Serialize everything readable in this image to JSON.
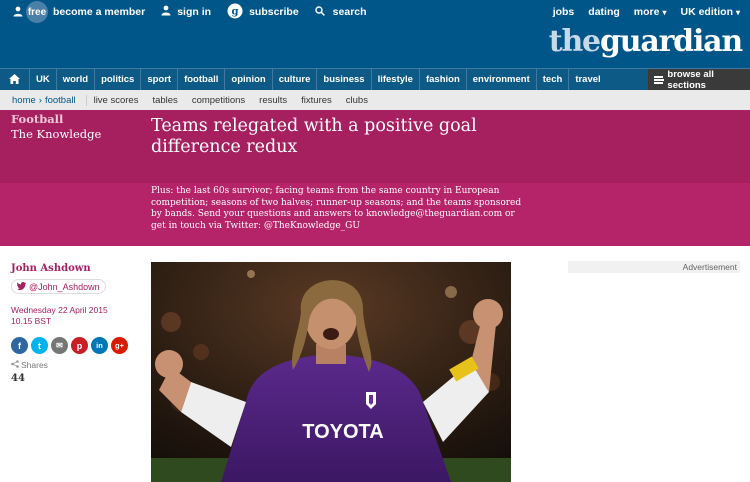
{
  "topbar": {
    "free_badge": "free",
    "become_member": "become a member",
    "sign_in": "sign in",
    "subscribe": "subscribe",
    "search": "search",
    "jobs": "jobs",
    "dating": "dating",
    "more": "more",
    "edition": "UK edition",
    "logo_the": "the",
    "logo_guardian": "guardian",
    "background_color": "#005689"
  },
  "nav": {
    "home_icon": "home-icon",
    "items": [
      "UK",
      "world",
      "politics",
      "sport",
      "football",
      "opinion",
      "culture",
      "business",
      "lifestyle",
      "fashion",
      "environment",
      "tech",
      "travel"
    ],
    "browse_all": "browse all sections"
  },
  "subnav": {
    "breadcrumb_home": "home",
    "breadcrumb_sep": "›",
    "breadcrumb_section": "football",
    "items": [
      "live scores",
      "tables",
      "competitions",
      "results",
      "fixtures",
      "clubs"
    ]
  },
  "article": {
    "section": "Football",
    "series": "The Knowledge",
    "headline": "Teams relegated with a positive goal difference redux",
    "standfirst": "Plus: the last 60s survivor; facing teams from the same country in European competition; seasons of two halves; runner-up seasons; and the teams sponsored by bands. Send your questions and answers to knowledge@theguardian.com or get in touch via Twitter: @TheKnowledge_GU",
    "author": "John Ashdown",
    "twitter_handle": "@John_Ashdown",
    "date": "Wednesday 22 April 2015",
    "time": "10.15 BST",
    "shares_label": "Shares",
    "shares_count": "44",
    "accent_color": "#a62060"
  },
  "share_buttons": [
    {
      "icon": "facebook-icon",
      "glyph": "f",
      "color": "#3067a3"
    },
    {
      "icon": "twitter-icon",
      "glyph": "t",
      "color": "#03b3ee"
    },
    {
      "icon": "email-icon",
      "glyph": "✉",
      "color": "#767676"
    },
    {
      "icon": "pinterest-icon",
      "glyph": "p",
      "color": "#cb1f27"
    },
    {
      "icon": "linkedin-icon",
      "glyph": "in",
      "color": "#0077b5"
    },
    {
      "icon": "googleplus-icon",
      "glyph": "g+",
      "color": "#d61d00"
    }
  ],
  "advert": {
    "label": "Advertisement"
  },
  "hero_image": {
    "shirt_text": "TOYOTA"
  }
}
